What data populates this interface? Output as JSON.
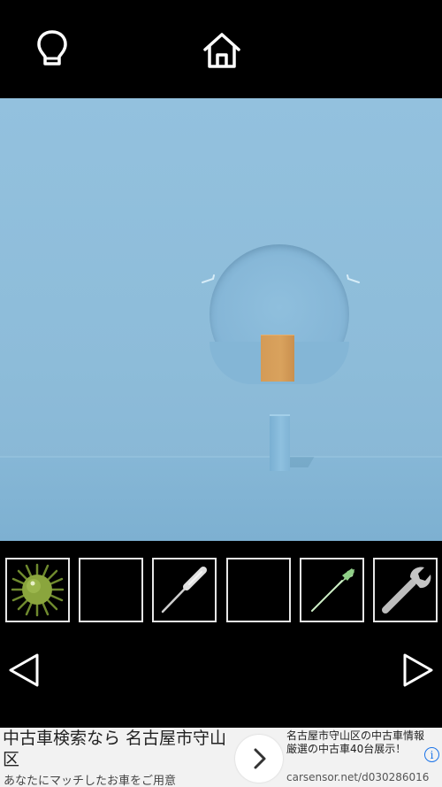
{
  "toolbar": {
    "hint_icon": "lightbulb-icon",
    "home_icon": "home-icon"
  },
  "scene": {
    "wall_color": "#93c1de",
    "floor_color": "#7fb2d3",
    "box_color": "#d49b57"
  },
  "inventory": {
    "slots": [
      {
        "item": "green-spiky-ball-icon"
      },
      {
        "item": "empty"
      },
      {
        "item": "screwdriver-icon"
      },
      {
        "item": "empty"
      },
      {
        "item": "green-horn-icon"
      },
      {
        "item": "wrench-icon"
      }
    ]
  },
  "navigation": {
    "left_icon": "arrow-left-icon",
    "right_icon": "arrow-right-icon"
  },
  "ad": {
    "headline": "中古車検索なら 名古屋市守山区",
    "subtext": "あなたにマッチしたお車をご用意",
    "right_text": "名古屋市守山区の中古車情報 厳選の中古車40台展示！",
    "url": "carsensor.net/d030286016",
    "info_symbol": "i"
  }
}
